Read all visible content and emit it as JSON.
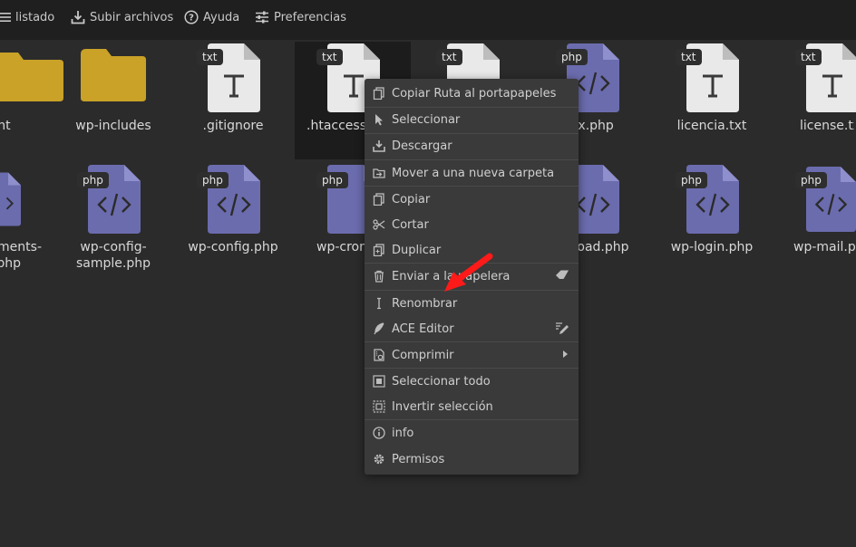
{
  "toolbar": {
    "listado": "listado",
    "subir": "Subir archivos",
    "ayuda": "Ayuda",
    "preferencias": "Preferencias"
  },
  "colors": {
    "background": "#2b2b2b",
    "toolbar": "#1f1f1f",
    "folder": "#c9a227",
    "php_doc": "#6b6cae",
    "txt_doc": "#e9e9e9",
    "menu": "#3a3a3a",
    "arrow": "#ff1a1a"
  },
  "files_row1": [
    {
      "name": "ntent",
      "kind": "folder"
    },
    {
      "name": "wp-includes",
      "kind": "folder"
    },
    {
      "name": ".gitignore",
      "kind": "txt",
      "badge": "txt"
    },
    {
      "name": ".htaccess",
      "kind": "txt",
      "badge": "txt"
    },
    {
      "name": "",
      "kind": "txt",
      "badge": "txt"
    },
    {
      "name": "lex.php",
      "kind": "php",
      "badge": "php"
    },
    {
      "name": "licencia.txt",
      "kind": "txt",
      "badge": "txt"
    },
    {
      "name": "license.txt",
      "kind": "txt",
      "badge": "txt"
    }
  ],
  "files_row2": [
    {
      "name": "ments-",
      "name2": "php",
      "kind": "php",
      "badge": ""
    },
    {
      "name": "wp-config-",
      "name2": "sample.php",
      "kind": "php",
      "badge": "php"
    },
    {
      "name": "wp-config.php",
      "kind": "php",
      "badge": "php"
    },
    {
      "name": "wp-cron",
      "kind": "php",
      "badge": "php"
    },
    {
      "name": "",
      "kind": "php",
      "badge": ""
    },
    {
      "name": "load.php",
      "kind": "php",
      "badge": ""
    },
    {
      "name": "wp-login.php",
      "kind": "php",
      "badge": "php"
    },
    {
      "name": "wp-mail.php",
      "kind": "php",
      "badge": "php"
    }
  ],
  "context_menu": {
    "items": [
      {
        "label": "Copiar Ruta al portapapeles",
        "icon": "copy-icon"
      },
      {
        "label": "Seleccionar",
        "icon": "pointer-icon"
      },
      {
        "label": "Descargar",
        "icon": "download-icon"
      },
      {
        "label": "Mover a una nueva carpeta",
        "icon": "folder-move-icon"
      },
      {
        "label": "Copiar",
        "icon": "copy-icon"
      },
      {
        "label": "Cortar",
        "icon": "scissors-icon"
      },
      {
        "label": "Duplicar",
        "icon": "duplicate-icon"
      },
      {
        "label": "Enviar a la papelera",
        "icon": "trash-icon"
      },
      {
        "label": "Renombrar",
        "icon": "text-cursor-icon"
      },
      {
        "label": "ACE Editor",
        "icon": "feather-icon"
      },
      {
        "label": "Comprimir",
        "icon": "compress-icon"
      },
      {
        "label": "Seleccionar todo",
        "icon": "select-all-icon"
      },
      {
        "label": "Invertir selección",
        "icon": "invert-selection-icon"
      },
      {
        "label": "info",
        "icon": "info-icon"
      },
      {
        "label": "Permisos",
        "icon": "gear-icon"
      }
    ]
  }
}
